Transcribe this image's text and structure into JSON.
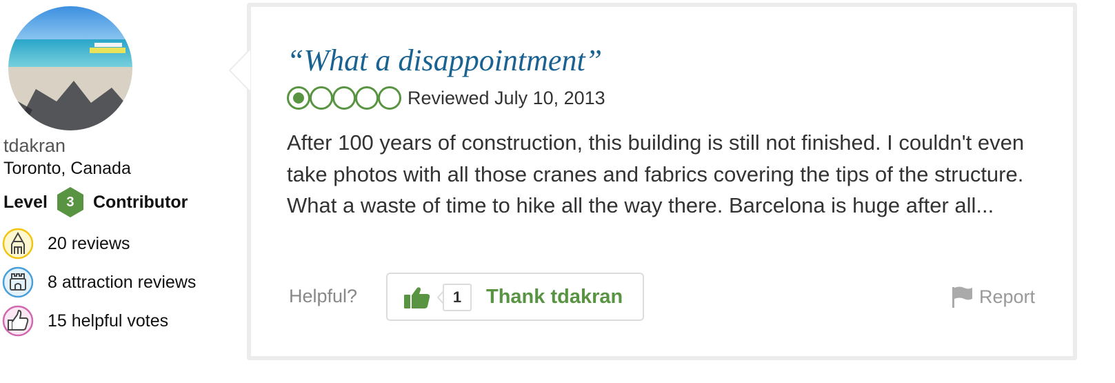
{
  "member": {
    "username": "tdakran",
    "location": "Toronto, Canada",
    "level_prefix": "Level",
    "level_number": "3",
    "level_suffix": "Contributor",
    "stats": [
      {
        "icon": "pencil-badge-icon",
        "label": "20 reviews"
      },
      {
        "icon": "attraction-badge-icon",
        "label": "8 attraction reviews"
      },
      {
        "icon": "thumbs-up-badge-icon",
        "label": "15 helpful votes"
      }
    ]
  },
  "review": {
    "title": "“What a disappointment”",
    "rating": 1,
    "rating_max": 5,
    "date": "Reviewed July 10, 2013",
    "body": "After 100 years of construction, this building is still not finished. I couldn't even take photos with all those cranes and fabrics covering the tips of the structure. What a waste of time to hike all the way there. Barcelona is huge after all..."
  },
  "actions": {
    "helpful_label": "Helpful?",
    "vote_count": "1",
    "thank_label": "Thank tdakran",
    "report_label": "Report"
  },
  "colors": {
    "accent_green": "#589442",
    "title_blue": "#1a6291",
    "border_gray": "#ececec"
  }
}
